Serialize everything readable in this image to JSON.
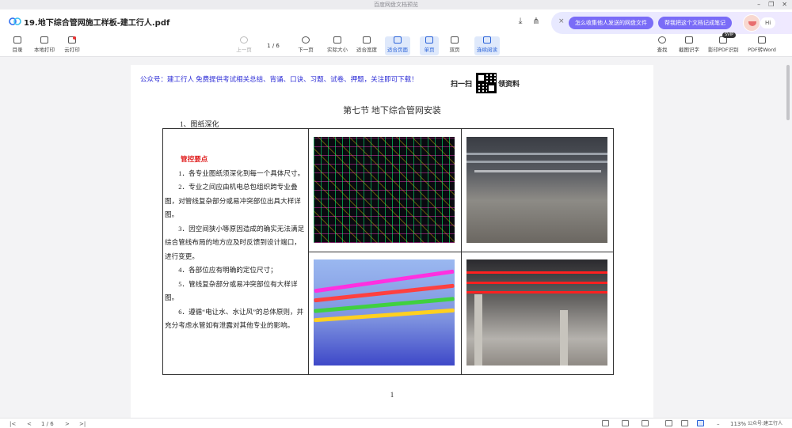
{
  "window": {
    "title": "百度网盘文档预览",
    "controls": [
      "–",
      "❐",
      "✕"
    ]
  },
  "file": {
    "name": "19.地下综合管网施工样板-建工行人.pdf"
  },
  "ai_panel": {
    "close": "×",
    "pill1": "怎么收集他人发送的网盘文件",
    "pill2": "帮我把这个文档记成笔记",
    "hi": "Hi"
  },
  "toolbar": {
    "left": [
      "目录",
      "本地打印",
      "云打印"
    ],
    "prev": "上一页",
    "page": "1 / 6",
    "next": "下一页",
    "actual_size": "实际大小",
    "fit_width": "适合宽度",
    "fit_page": "适合页面",
    "single": "单页",
    "double": "双页",
    "continuous": "连续阅读",
    "right": [
      "查找",
      "截图识字",
      "影印PDF识别",
      "PDF转Word"
    ],
    "svip_badge": "SVIP"
  },
  "document": {
    "wechat_line": "公众号：建工行人 免费提供考试相关总结、背诵、口诀、习题、试卷、押题，关注即可下载！",
    "qr_left": "扫一扫",
    "qr_right": "领资料",
    "section_title": "第七节 地下综合管网安装",
    "subheading": "1、图纸深化",
    "control_heading": "管控要点",
    "points": [
      "1．各专业图纸须深化到每一个具体尺寸。",
      "2．专业之间应由机电总包组织跨专业叠图，对管线复杂部分或易冲突部位出具大样详图。",
      "3．因空间狭小等原因造成的确实无法满足综合管线布局的地方应及时反馈到设计端口，进行变更。",
      "4．各部位应有明确的定位尺寸；",
      "5．管线复杂部分或易冲突部位有大样详图。",
      "6．遵循“电让水、水让风”的总体原则，并充分考虑水管如有泄露对其他专业的影响。"
    ],
    "page_number": "1"
  },
  "bottombar": {
    "first": "|<",
    "prev": "<",
    "page": "1 / 6",
    "next": ">",
    "last": ">|",
    "zoom": "113%",
    "watermark": "公众号:建工行人"
  }
}
